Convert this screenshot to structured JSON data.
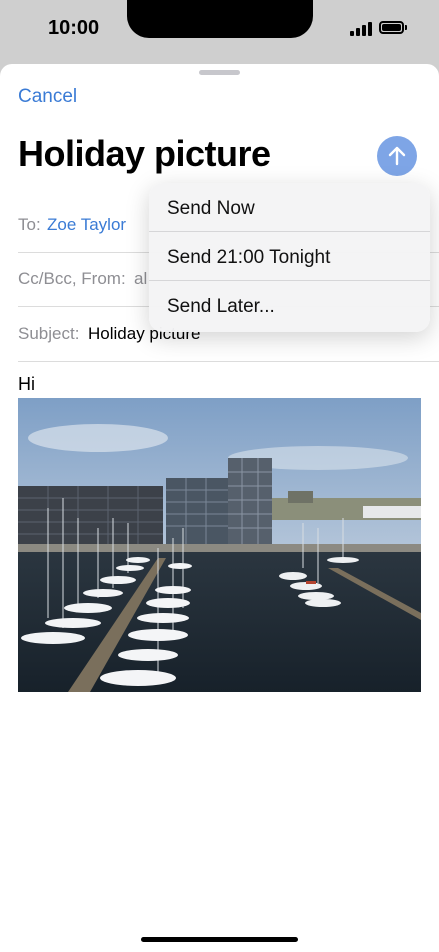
{
  "status_bar": {
    "time": "10:00"
  },
  "compose": {
    "cancel_label": "Cancel",
    "title": "Holiday picture",
    "to_label": "To:",
    "to_value": "Zoe Taylor",
    "cc_label": "Cc/Bcc, From:",
    "cc_value": "al",
    "subject_label": "Subject:",
    "subject_value": "Holiday picture",
    "body_text": "Hi"
  },
  "send_menu": {
    "items": [
      {
        "label": "Send Now"
      },
      {
        "label": "Send 21:00 Tonight"
      },
      {
        "label": "Send Later..."
      }
    ]
  },
  "colors": {
    "accent": "#3a7bd5",
    "send_button": "#7ea5e6"
  }
}
